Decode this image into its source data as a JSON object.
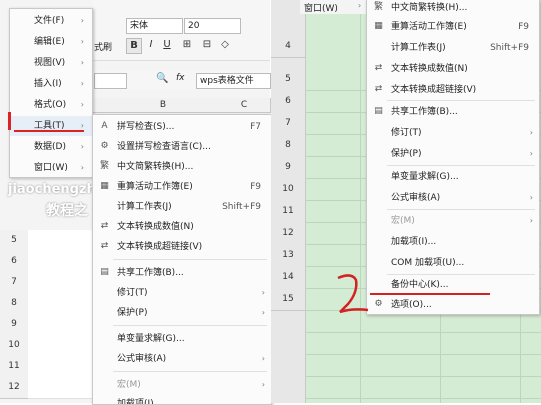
{
  "toolbar": {
    "font_name": "宋体",
    "font_size": "20",
    "format_painter_label": "式刷",
    "bold": "B",
    "italic": "I",
    "underline": "U",
    "cell_ref_icon": "Q",
    "fx_label": "fx",
    "formula_value": "wps表格文件",
    "col_b": "B",
    "col_c": "C"
  },
  "main_menu": {
    "items": [
      {
        "label": "文件(F)"
      },
      {
        "label": "编辑(E)"
      },
      {
        "label": "视图(V)"
      },
      {
        "label": "插入(I)"
      },
      {
        "label": "格式(O)"
      },
      {
        "label": "工具(T)"
      },
      {
        "label": "数据(D)"
      },
      {
        "label": "窗口(W)"
      }
    ]
  },
  "tools_menu": {
    "items": [
      {
        "icon": "spellcheck-icon",
        "label": "拼写检查(S)...",
        "shortcut": "F7"
      },
      {
        "icon": "language-icon",
        "label": "设置拼写检查语言(C)...",
        "shortcut": ""
      },
      {
        "icon": "chinese-convert-icon",
        "label": "中文简繁转换(H)...",
        "shortcut": ""
      },
      {
        "icon": "recalc-icon",
        "label": "重算活动工作簿(E)",
        "shortcut": "F9"
      },
      {
        "icon": "",
        "label": "计算工作表(J)",
        "shortcut": "Shift+F9"
      },
      {
        "icon": "text-to-number-icon",
        "label": "文本转换成数值(N)",
        "shortcut": ""
      },
      {
        "icon": "text-to-link-icon",
        "label": "文本转换成超链接(V)",
        "shortcut": ""
      },
      {
        "icon": "share-workbook-icon",
        "label": "共享工作簿(B)...",
        "shortcut": ""
      },
      {
        "icon": "",
        "label": "修订(T)",
        "shortcut": ""
      },
      {
        "icon": "",
        "label": "保护(P)",
        "shortcut": ""
      },
      {
        "icon": "",
        "label": "单变量求解(G)...",
        "shortcut": ""
      },
      {
        "icon": "",
        "label": "公式审核(A)",
        "shortcut": ""
      },
      {
        "icon": "",
        "label": "宏(M)",
        "shortcut": ""
      },
      {
        "icon": "",
        "label": "加载项(I)...",
        "shortcut": ""
      }
    ]
  },
  "right_menu": {
    "window_label": "窗口(W)",
    "items": [
      {
        "icon": "chinese-convert-icon",
        "label": "中文简繁转换(H)...",
        "shortcut": ""
      },
      {
        "icon": "recalc-icon",
        "label": "重算活动工作簿(E)",
        "shortcut": "F9"
      },
      {
        "icon": "",
        "label": "计算工作表(J)",
        "shortcut": "Shift+F9"
      },
      {
        "icon": "text-to-number-icon",
        "label": "文本转换成数值(N)",
        "shortcut": ""
      },
      {
        "icon": "text-to-link-icon",
        "label": "文本转换成超链接(V)",
        "shortcut": ""
      },
      {
        "icon": "share-workbook-icon",
        "label": "共享工作簿(B)...",
        "shortcut": ""
      },
      {
        "icon": "",
        "label": "修订(T)",
        "shortcut": ""
      },
      {
        "icon": "",
        "label": "保护(P)",
        "shortcut": ""
      },
      {
        "icon": "",
        "label": "单变量求解(G)...",
        "shortcut": ""
      },
      {
        "icon": "",
        "label": "公式审核(A)",
        "shortcut": ""
      },
      {
        "icon": "",
        "label": "宏(M)",
        "shortcut": ""
      },
      {
        "icon": "",
        "label": "加载项(I)...",
        "shortcut": ""
      },
      {
        "icon": "",
        "label": "COM 加载项(U)...",
        "shortcut": ""
      },
      {
        "icon": "",
        "label": "备份中心(K)...",
        "shortcut": ""
      },
      {
        "icon": "gear-icon",
        "label": "选项(O)...",
        "shortcut": ""
      }
    ]
  },
  "left_rows": [
    "5",
    "6",
    "7",
    "8",
    "9",
    "10",
    "11",
    "12"
  ],
  "right_rows": [
    "4",
    "5",
    "6",
    "7",
    "8",
    "9",
    "10",
    "11",
    "12",
    "13",
    "14",
    "15"
  ],
  "annotations": {
    "step1": "1",
    "step2": "2"
  },
  "watermark": {
    "line1": "jiaochengzhi",
    "line2": "教程之"
  },
  "colors": {
    "annotation_red": "#d22222",
    "sheet_green": "#d4ebd4"
  }
}
